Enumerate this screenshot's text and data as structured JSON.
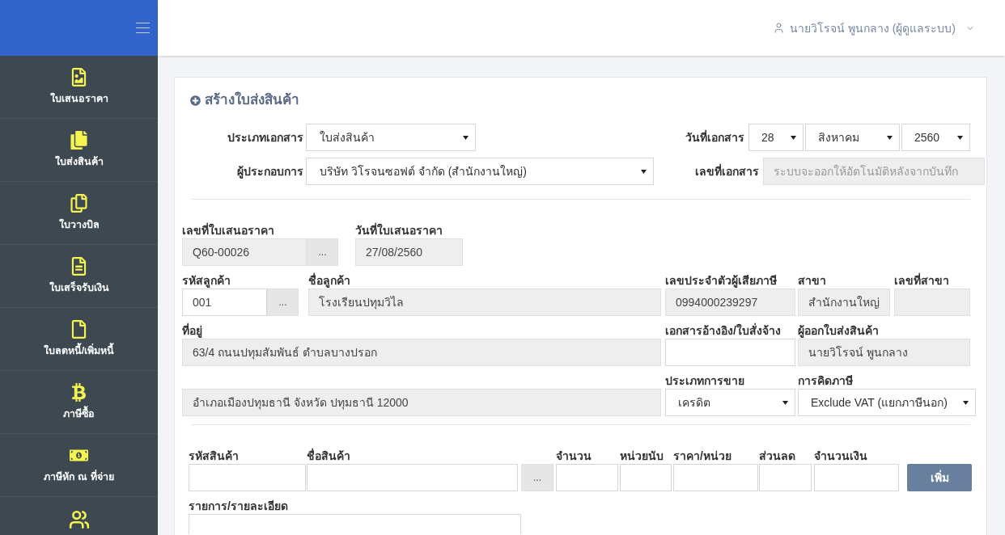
{
  "sidebar": {
    "items": [
      {
        "label": "ใบเสนอราคา"
      },
      {
        "label": "ใบส่งสินค้า"
      },
      {
        "label": "ใบวางบิล"
      },
      {
        "label": "ใบเสร็จรับเงิน"
      },
      {
        "label": "ใบลดหนี้/เพิ่มหนี้"
      },
      {
        "label": "ภาษีซื้อ"
      },
      {
        "label": "ภาษีหัก ณ ที่จ่าย"
      }
    ]
  },
  "header": {
    "user": {
      "name": "นายวิโรจน์ พูนกลาง (ผู้ดูแลระบบ)"
    }
  },
  "form": {
    "title": "สร้างใบส่งสินค้า",
    "document": {
      "type": {
        "label": "ประเภทเอกสาร",
        "value": "ใบส่งสินค้า"
      },
      "company": {
        "label": "ผู้ประกอบการ",
        "value": "บริษัท วิโรจนซอฟต์ จำกัด (สำนักงานใหญ่)"
      },
      "date": {
        "label": "วันที่เอกสาร",
        "day": "28",
        "month": "สิงหาคม",
        "year": "2560"
      },
      "number": {
        "label": "เลขที่เอกสาร",
        "placeholder": "ระบบจะออกให้อัตโนมัติหลังจากบันทึก",
        "disabled": true
      }
    },
    "customer_rows": [
      {
        "fields": [
          {
            "kind": "lookup",
            "label": "เลขที่ใบเสนอราคา",
            "value": "Q60-00026",
            "readonly": true,
            "button": "..."
          },
          {
            "kind": "input",
            "label": "วันที่ใบเสนอราคา",
            "value": "27/08/2560",
            "readonly": true
          }
        ]
      },
      {
        "fields": [
          {
            "kind": "lookup",
            "label": "รหัสลูกค้า",
            "value": "001",
            "readonly": false,
            "button": "..."
          },
          {
            "kind": "input",
            "label": "ชื่อลูกค้า",
            "value": "โรงเรียนปทุมวิไล",
            "readonly": true
          },
          {
            "kind": "input",
            "label": "เลขประจำตัวผู้เสียภาษี",
            "value": "0994000239297",
            "readonly": true
          },
          {
            "kind": "input",
            "label": "สาขา",
            "value": "สำนักงานใหญ่",
            "readonly": true
          },
          {
            "kind": "input",
            "label": "เลขที่สาขา",
            "readonly": true
          }
        ]
      },
      {
        "fields": [
          {
            "kind": "input",
            "label": "ที่อยู่",
            "value": "63/4 ถนนปทุมสัมพันธ์ ตำบลบางปรอก",
            "readonly": true
          },
          {
            "kind": "input",
            "label": "เอกสารอ้างอิง/ใบสั่งจ้าง",
            "readonly": false
          },
          {
            "kind": "input",
            "label": "ผู้ออกใบส่งสินค้า",
            "value": "นายวิโรจน์ พูนกลาง",
            "readonly": true
          }
        ]
      },
      {
        "fields": [
          {
            "kind": "input",
            "value": "อำเภอเมืองปทุมธานี จังหวัด ปทุมธานี 12000",
            "readonly": true
          },
          {
            "kind": "select",
            "label": "ประเภทการขาย",
            "value": "เครดิต"
          },
          {
            "kind": "select",
            "label": "การคิดภาษี",
            "value": "Exclude VAT (แยกภาษีนอก)"
          }
        ]
      }
    ],
    "item_row": [
      {
        "kind": "input",
        "label": "รหัสสินค้า",
        "readonly": false
      },
      {
        "kind": "input",
        "label": "ชื่อสินค้า",
        "readonly": false
      },
      {
        "kind": "button",
        "text": "..."
      },
      {
        "kind": "input",
        "label": "จำนวน",
        "readonly": false
      },
      {
        "kind": "input",
        "label": "หน่วยนับ",
        "readonly": false
      },
      {
        "kind": "input",
        "label": "ราคา/หน่วย",
        "readonly": false
      },
      {
        "kind": "input",
        "label": "ส่วนลด",
        "readonly": false
      },
      {
        "kind": "input",
        "label": "จำนวนเงิน",
        "readonly": false
      },
      {
        "kind": "primary_button",
        "text": "เพิ่ม"
      }
    ],
    "detail": {
      "label": "รายการ/รายละเอียด"
    }
  }
}
